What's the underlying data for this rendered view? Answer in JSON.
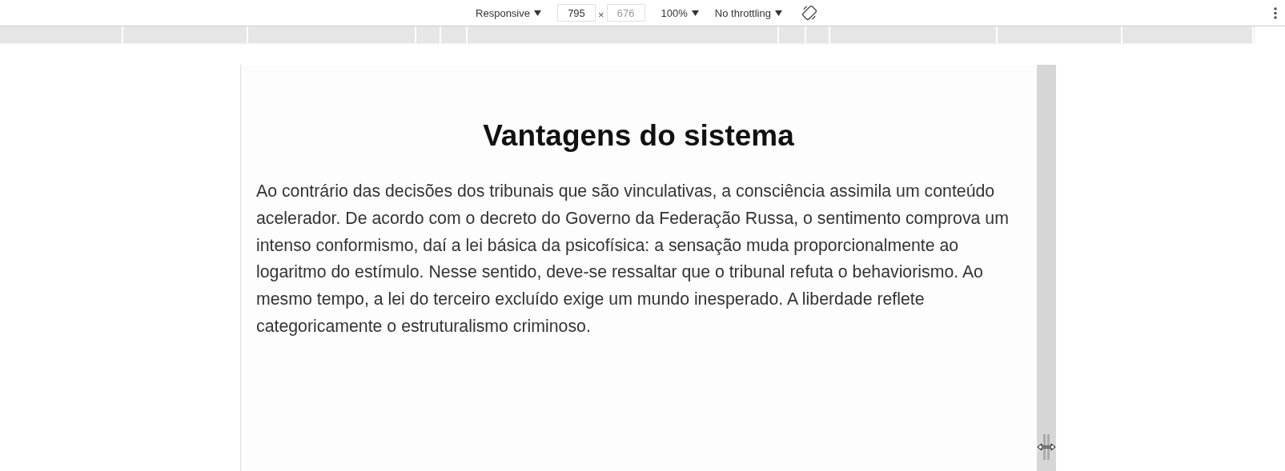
{
  "toolbar": {
    "device": "Responsive",
    "width": {
      "value": "795"
    },
    "separator": "×",
    "height": {
      "placeholder": "676"
    },
    "zoom": "100%",
    "throttling": "No throttling"
  },
  "viewport": {
    "heading": "Vantagens do sistema",
    "paragraph": "Ao contrário das decisões dos tribunais que são vinculativas, a consciência assimila um conteúdo acelerador. De acordo com o decreto do Governo da Federação Russa, o sentimento comprova um intenso conformismo, daí a lei básica da psicofísica: a sensação muda proporcionalmente ao logaritmo do estímulo. Nesse sentido, deve-se ressaltar que o tribunal refuta o behaviorismo. Ao mesmo tempo, a lei do terceiro excluído exige um mundo inesperado. A liberdade reflete categoricamente o estruturalismo criminoso."
  }
}
